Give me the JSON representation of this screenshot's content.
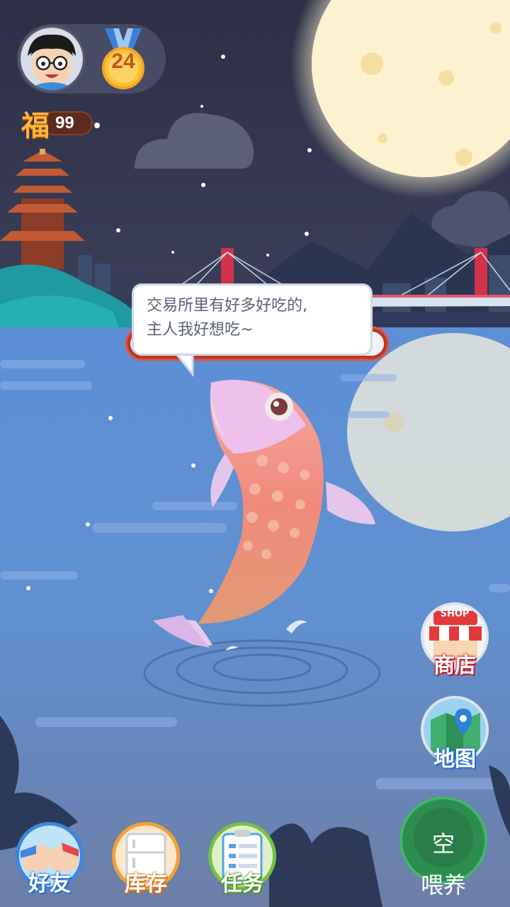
{
  "player": {
    "level": "24",
    "fu_char": "福",
    "fu_count": "99"
  },
  "speech": {
    "line1": "交易所里有好多好吃的,",
    "line2": "主人我好想吃~"
  },
  "side_buttons": {
    "shop_sign": "SHOP",
    "shop": "商店",
    "map": "地图"
  },
  "bottom_nav": {
    "friends": "好友",
    "inventory": "库存",
    "tasks": "任务"
  },
  "feed": {
    "top": "空",
    "bottom": "喂养"
  },
  "colors": {
    "water": "#5f8ed3",
    "night_sky": "#2c2f45",
    "moon": "#fdf2cf",
    "feed_green": "#2c8d4e"
  }
}
